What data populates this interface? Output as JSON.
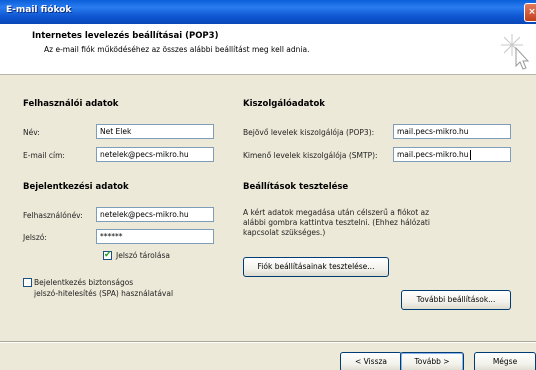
{
  "window": {
    "title": "E-mail fiókok",
    "close_glyph": "×",
    "close_icon": "close-icon"
  },
  "header": {
    "title": "Internetes levelezés beállításai (POP3)",
    "subtitle": "Az e-mail fiók működéséhez az összes alábbi beállítást meg kell adnia.",
    "icon": "wizard-sparkle-icon"
  },
  "user": {
    "section": "Felhasználói adatok",
    "name_label": "Név:",
    "name_value": "Net Elek",
    "email_label": "E-mail cím:",
    "email_value": "netelek@pecs-mikro.hu"
  },
  "server": {
    "section": "Kiszolgálóadatok",
    "incoming_label": "Bejövő levelek kiszolgálója (POP3):",
    "incoming_value": "mail.pecs-mikro.hu",
    "outgoing_label": "Kimenő levelek kiszolgálója (SMTP):",
    "outgoing_value": "mail.pecs-mikro.hu"
  },
  "login": {
    "section": "Bejelentkezési adatok",
    "username_label": "Felhasználónév:",
    "username_value": "netelek@pecs-mikro.hu",
    "password_label": "Jelszó:",
    "password_value": "******",
    "remember_label": "Jelszó tárolása",
    "remember_checked": true,
    "spa_label_line1": "Bejelentkezés biztonságos",
    "spa_label_line2": "jelszó-hitelesítés (SPA) használatával",
    "spa_checked": false
  },
  "test": {
    "section": "Beállítások tesztelése",
    "desc_line1": "A kért adatok megadása után célszerű a fiókot az",
    "desc_line2": "alábbi gombra kattintva tesztelni. (Ehhez hálózati",
    "desc_line3": "kapcsolat szükséges.)",
    "test_button": "Fiók beállításainak tesztelése...",
    "more_button": "További beállítások..."
  },
  "footer": {
    "back_button": "< Vissza",
    "next_button": "Tovább >",
    "cancel_button": "Mégse"
  },
  "colors": {
    "titlebar": "#0a5fd8",
    "dialog_bg": "#ece9d8",
    "input_border": "#7f9db9",
    "button_border": "#003c74",
    "checkmark": "#21a121"
  }
}
